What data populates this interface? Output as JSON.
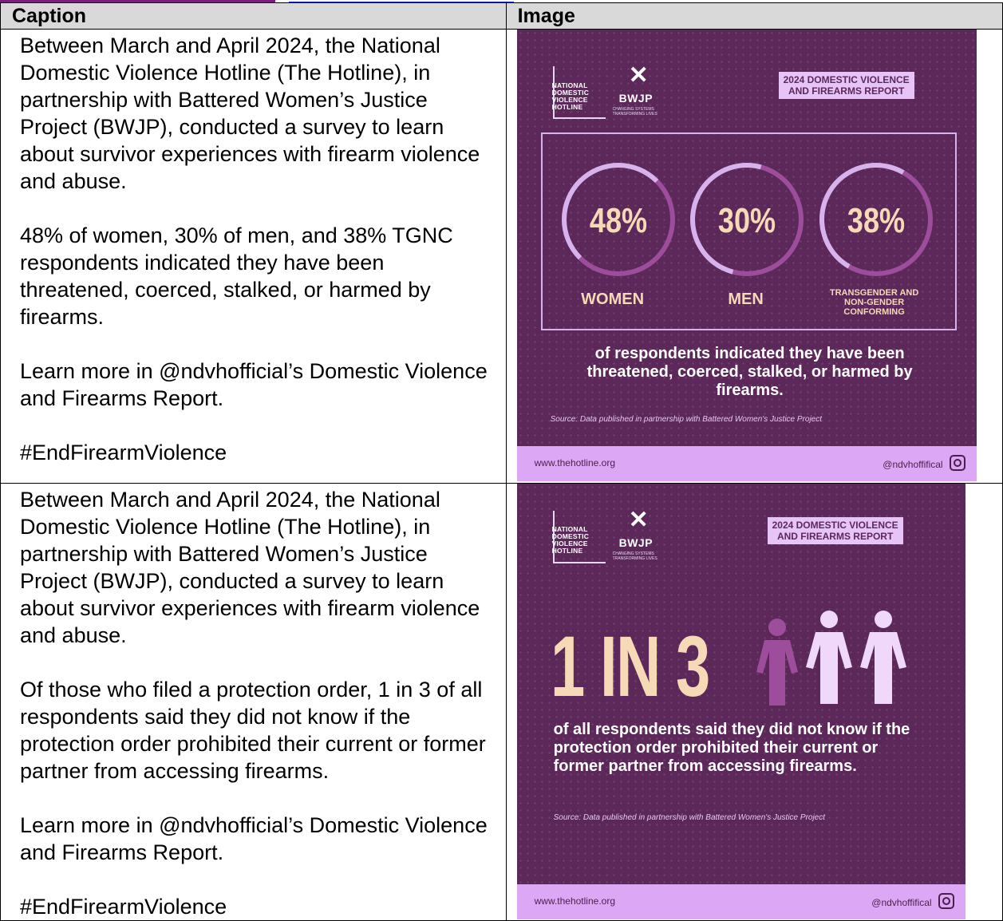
{
  "table": {
    "header_caption": "Caption",
    "header_image": "Image"
  },
  "rows": [
    {
      "caption": [
        "Between March and April 2024, the National Domestic Violence Hotline (The Hotline), in partnership with Battered Women’s Justice Project (BWJP), conducted a survey to learn about survivor experiences with firearm violence and abuse.",
        "48% of women, 30% of men, and 38% TGNC respondents indicated they have been threatened, coerced, stalked, or harmed by firearms.",
        "Learn more in @ndvhofficial’s Domestic Violence and Firearms Report.",
        "#EndFirearmViolence"
      ],
      "graphic": {
        "logo": "NATIONAL\nDOMESTIC\nVIOLENCE\nHOTLINE",
        "bwjp": "BWJP",
        "bwjp_tagline": "CHANGING SYSTEMS TRANSFORMING LIVES",
        "badge": "2024 DOMESTIC VIOLENCE\nAND FIREARMS REPORT",
        "stats": [
          {
            "pct": "48%",
            "label": "WOMEN",
            "value": 0.48
          },
          {
            "pct": "30%",
            "label": "MEN",
            "value": 0.3
          },
          {
            "pct": "38%",
            "label": "TRANSGENDER AND NON-GENDER CONFORMING",
            "value": 0.38
          }
        ],
        "body": "of respondents indicated they have been threatened, coerced, stalked, or harmed by firearms.",
        "source": "Source: Data published in partnership with Battered Women's Justice Project",
        "url": "www.thehotline.org",
        "handle": "@ndvhoffifical"
      }
    },
    {
      "caption": [
        "Between March and April 2024, the National Domestic Violence Hotline (The Hotline), in partnership with Battered Women’s Justice Project (BWJP), conducted a survey to learn about survivor experiences with firearm violence and abuse.",
        "Of those who filed a protection order, 1 in 3 of all respondents said they did not know if the protection order prohibited their current or former partner from accessing firearms.",
        "Learn more in @ndvhofficial’s Domestic Violence and Firearms Report.",
        "#EndFirearmViolence"
      ],
      "graphic": {
        "logo": "NATIONAL\nDOMESTIC\nVIOLENCE\nHOTLINE",
        "bwjp": "BWJP",
        "bwjp_tagline": "CHANGING SYSTEMS TRANSFORMING LIVES",
        "badge": "2024 DOMESTIC VIOLENCE\nAND FIREARMS REPORT",
        "big_stat": "1 IN 3",
        "body": "of all respondents said they did not know if the protection order prohibited their current or former partner from accessing firearms.",
        "source": "Source: Data published in partnership with Battered Women's Justice Project",
        "url": "www.thehotline.org",
        "handle": "@ndvhoffifical"
      }
    }
  ]
}
